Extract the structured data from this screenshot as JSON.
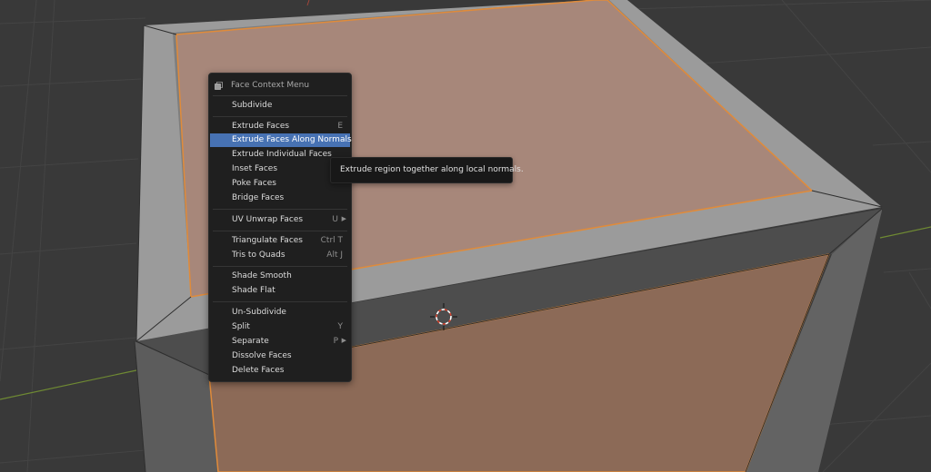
{
  "viewport": {
    "background": "#393939",
    "cube_face_color": "#a7877a",
    "cube_side_face_color": "#8c6a57",
    "cube_bevel_color": "#9c9c9c",
    "selection_outline_color": "#e08b3a",
    "x_axis_color": "#6f8a33"
  },
  "menu": {
    "title": "Face Context Menu",
    "header_icon": "face-select-icon",
    "active_color": "#4772b3",
    "items": [
      {
        "label": "Subdivide",
        "shortcut": "",
        "submenu": false
      },
      {
        "label": "Extrude Faces",
        "shortcut": "E",
        "submenu": false
      },
      {
        "label": "Extrude Faces Along Normals",
        "shortcut": "",
        "submenu": false,
        "active": true
      },
      {
        "label": "Extrude Individual Faces",
        "shortcut": "",
        "submenu": false
      },
      {
        "label": "Inset Faces",
        "shortcut": "",
        "submenu": false
      },
      {
        "label": "Poke Faces",
        "shortcut": "",
        "submenu": false
      },
      {
        "label": "Bridge Faces",
        "shortcut": "",
        "submenu": false
      },
      {
        "label": "UV Unwrap Faces",
        "shortcut": "U",
        "submenu": true
      },
      {
        "label": "Triangulate Faces",
        "shortcut": "Ctrl T",
        "submenu": false
      },
      {
        "label": "Tris to Quads",
        "shortcut": "Alt J",
        "submenu": false
      },
      {
        "label": "Shade Smooth",
        "shortcut": "",
        "submenu": false
      },
      {
        "label": "Shade Flat",
        "shortcut": "",
        "submenu": false
      },
      {
        "label": "Un-Subdivide",
        "shortcut": "",
        "submenu": false
      },
      {
        "label": "Split",
        "shortcut": "Y",
        "submenu": false
      },
      {
        "label": "Separate",
        "shortcut": "P",
        "submenu": true
      },
      {
        "label": "Dissolve Faces",
        "shortcut": "",
        "submenu": false
      },
      {
        "label": "Delete Faces",
        "shortcut": "",
        "submenu": false
      }
    ]
  },
  "tooltip": {
    "text": "Extrude region together along local normals."
  },
  "cursor_3d": "3d-cursor-icon"
}
